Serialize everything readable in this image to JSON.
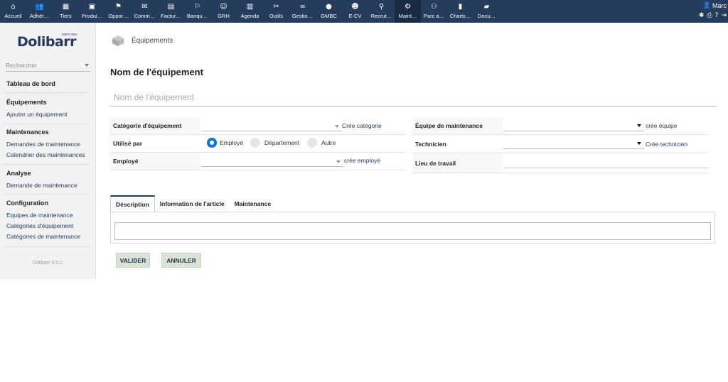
{
  "topmenu": [
    {
      "label": "Accueil",
      "icon": "home-icon",
      "glyph": "⌂"
    },
    {
      "label": "Adhér…",
      "icon": "members-icon",
      "glyph": "👥"
    },
    {
      "label": "Tiers",
      "icon": "building-icon",
      "glyph": "▦"
    },
    {
      "label": "Produi…",
      "icon": "products-icon",
      "glyph": "▣"
    },
    {
      "label": "Oppor…",
      "icon": "sitemap-icon",
      "glyph": "⚑"
    },
    {
      "label": "Comm…",
      "icon": "commerce-icon",
      "glyph": "✉"
    },
    {
      "label": "Factur…",
      "icon": "billing-icon",
      "glyph": "▤"
    },
    {
      "label": "Banqu…",
      "icon": "bank-icon",
      "glyph": "⚐"
    },
    {
      "label": "GRH",
      "icon": "hrm-icon",
      "glyph": "☺"
    },
    {
      "label": "Agenda",
      "icon": "agenda-icon",
      "glyph": "▥"
    },
    {
      "label": "Outils",
      "icon": "tools-icon",
      "glyph": "✂"
    },
    {
      "label": "Gestio…",
      "icon": "glasses-icon",
      "glyph": "∞"
    },
    {
      "label": "GMBC",
      "icon": "gmbc-icon",
      "glyph": "●"
    },
    {
      "label": "E-CV",
      "icon": "cv-icon",
      "glyph": "☻"
    },
    {
      "label": "Recrut…",
      "icon": "search-person-icon",
      "glyph": "⚲"
    },
    {
      "label": "Maint…",
      "icon": "gear-icon",
      "glyph": "⚙"
    },
    {
      "label": "Parc a…",
      "icon": "fleet-icon",
      "glyph": "⚇"
    },
    {
      "label": "Charts…",
      "icon": "charts-icon",
      "glyph": "▮"
    },
    {
      "label": "Docu…",
      "icon": "document-icon",
      "glyph": "▰"
    }
  ],
  "active_menu_index": 15,
  "user": {
    "name": "Marc"
  },
  "sidebar": {
    "logo_text": "Dolibarr",
    "logo_sup": "ERP/CRM",
    "search_placeholder": "Rechercher",
    "dashboard": "Tableau de bord",
    "equipements": {
      "title": "Équipements",
      "items": [
        "Ajouter un équipement"
      ]
    },
    "maintenances": {
      "title": "Maintenances",
      "items": [
        "Demandes de maintenance",
        "Calendrier des maintenances"
      ]
    },
    "analyse": {
      "title": "Analyse",
      "items": [
        "Demande de maintenance"
      ]
    },
    "configuration": {
      "title": "Configuration",
      "items": [
        "Equipes de maintenance",
        "Catégories d'équipement",
        "Catégories de maintenance"
      ]
    },
    "version": "Dolibarr 9.0.0"
  },
  "breadcrumb": "Équipements",
  "page_title": "Nom de l'équipement",
  "name_placeholder": "Nom de l'équipement",
  "form_left": {
    "category_label": "Catégorie d'équipement",
    "category_link": "Crée catégorie",
    "used_by_label": "Utilisé par",
    "radio_options": [
      "Employé",
      "Département",
      "Autre"
    ],
    "employee_label": "Employé",
    "employee_link": "crée employé"
  },
  "form_right": {
    "team_label": "Équipe de maintenance",
    "team_link": "crée équipe",
    "tech_label": "Technicien",
    "tech_link": "Crée technicien",
    "workplace_label": "Lieu de travail"
  },
  "tabs": [
    "Déscription",
    "Information de l'article",
    "Maintenance"
  ],
  "buttons": {
    "validate": "VALIDER",
    "cancel": "ANNULER"
  }
}
